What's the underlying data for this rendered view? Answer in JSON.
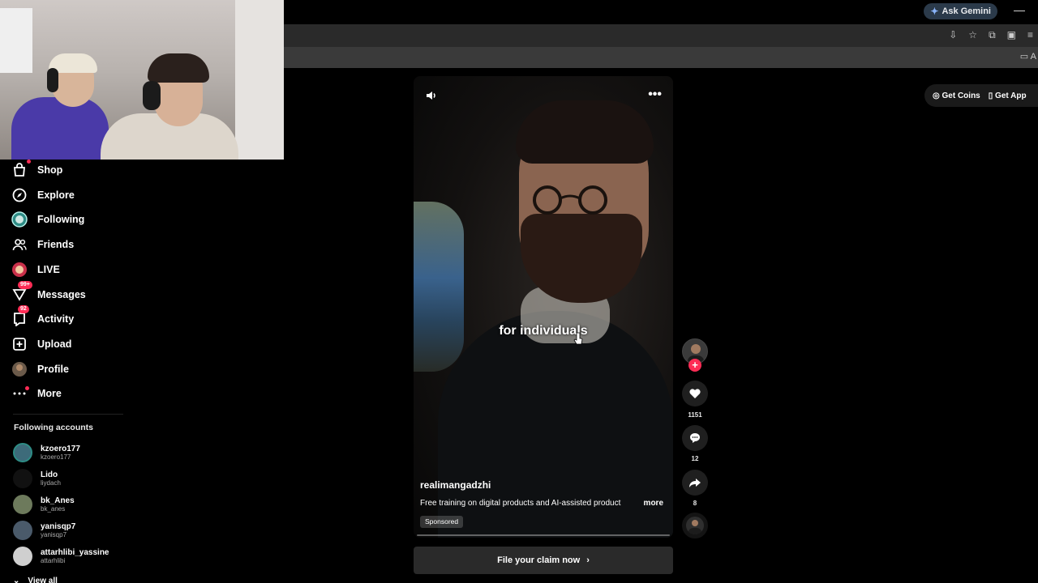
{
  "browser": {
    "gemini_label": "Ask Gemini",
    "minimize_label": "—",
    "bookmark_folder": "A"
  },
  "sidebar": {
    "items": [
      {
        "label": "Shop",
        "icon": "shop-bag-icon"
      },
      {
        "label": "Explore",
        "icon": "compass-icon"
      },
      {
        "label": "Following",
        "icon": "following-avatar-icon"
      },
      {
        "label": "Friends",
        "icon": "friends-icon"
      },
      {
        "label": "LIVE",
        "icon": "live-icon"
      },
      {
        "label": "Messages",
        "icon": "messages-icon",
        "badge": "99+"
      },
      {
        "label": "Activity",
        "icon": "activity-icon",
        "badge": "92"
      },
      {
        "label": "Upload",
        "icon": "upload-icon"
      },
      {
        "label": "Profile",
        "icon": "profile-avatar-icon"
      },
      {
        "label": "More",
        "icon": "more-dots-icon"
      }
    ],
    "following_title": "Following accounts",
    "accounts": [
      {
        "name": "kzoero177",
        "handle": "kzoero177",
        "color": "#3d6b7a"
      },
      {
        "name": "Lido",
        "handle": "liydach",
        "color": "#111111"
      },
      {
        "name": "bk_Anes",
        "handle": "bk_anes",
        "color": "#6d7a5c"
      },
      {
        "name": "yanisqp7",
        "handle": "yanisqp7",
        "color": "#4a5a6a"
      },
      {
        "name": "attarhlibi_yassine",
        "handle": "attarhlibi",
        "color": "#cfcfcf"
      }
    ],
    "view_all": "View all"
  },
  "top_actions": {
    "coins_label": "Get Coins",
    "app_label": "Get App"
  },
  "video": {
    "caption": "for individuals",
    "author": "realimangadzhi",
    "description": "Free training on digital products and AI-assisted product",
    "more_label": "more",
    "sponsored_label": "Sponsored",
    "menu_glyph": "•••",
    "cta_label": "File your claim now",
    "cta_arrow": "›"
  },
  "actions": {
    "likes": "1151",
    "comments": "12",
    "shares": "8",
    "follow_glyph": "+"
  },
  "colors": {
    "accent": "#fe2c55",
    "background": "#000000"
  }
}
